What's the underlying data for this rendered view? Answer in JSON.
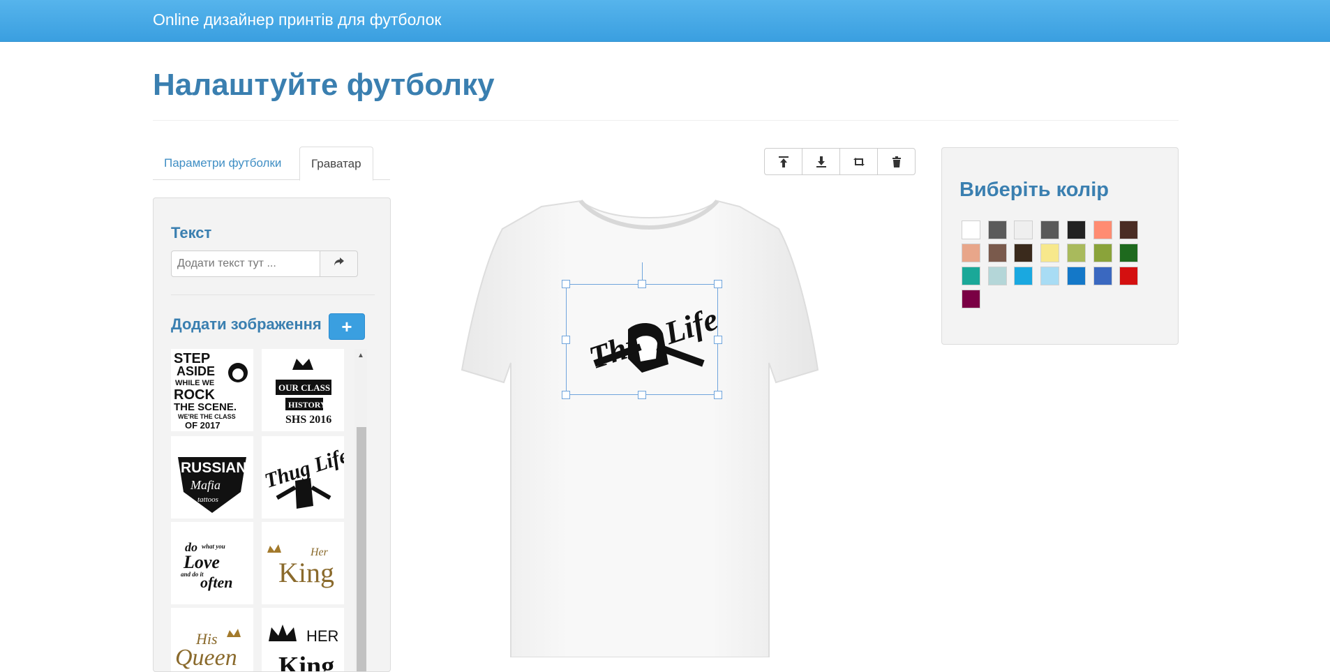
{
  "header": {
    "brand": "Online дизайнер принтів для футболок"
  },
  "page": {
    "title": "Налаштуйте футболку"
  },
  "tabs": [
    {
      "label": "Параметри футболки",
      "active": false
    },
    {
      "label": "Граватар",
      "active": true
    }
  ],
  "left_panel": {
    "text_heading": "Текст",
    "text_placeholder": "Додати текст тут ...",
    "text_submit_icon": "share-arrow-icon",
    "images_heading": "Додати зображення",
    "add_image_icon": "plus-icon",
    "gallery": [
      {
        "text": "STEP ASIDE WHILE WE ROCK THE SCENE. WE'RE THE CLASS OF 2017"
      },
      {
        "text": "OUR CLASS HISTORY SHS 2016"
      },
      {
        "text": "RUSSIAN Mafia tattoos"
      },
      {
        "text": "Thug Life"
      },
      {
        "text": "do what you Love and do it often"
      },
      {
        "text": "Her King"
      },
      {
        "text": "His Queen"
      },
      {
        "text": "HER King"
      }
    ]
  },
  "toolbar": {
    "buttons": [
      {
        "name": "bring-to-front",
        "icon": "align-top-icon"
      },
      {
        "name": "send-to-back",
        "icon": "align-bottom-icon"
      },
      {
        "name": "flip",
        "icon": "retweet-icon"
      },
      {
        "name": "delete",
        "icon": "trash-icon"
      }
    ]
  },
  "canvas": {
    "selected_print": "Thug Life"
  },
  "color_panel": {
    "heading": "Виберіть колір",
    "colors": [
      "#ffffff",
      "#5b5b5b",
      "#efefef",
      "#595959",
      "#222222",
      "#ff8c72",
      "#4a2c24",
      "#e8a68a",
      "#7a5a4c",
      "#3a2a1c",
      "#f7e88c",
      "#a9ba5c",
      "#8aa33a",
      "#1e6a1e",
      "#1aa898",
      "#b4d6d8",
      "#1aa8e0",
      "#a8dcf4",
      "#1478c8",
      "#3a68c0",
      "#d41010",
      "#7a0044"
    ]
  }
}
